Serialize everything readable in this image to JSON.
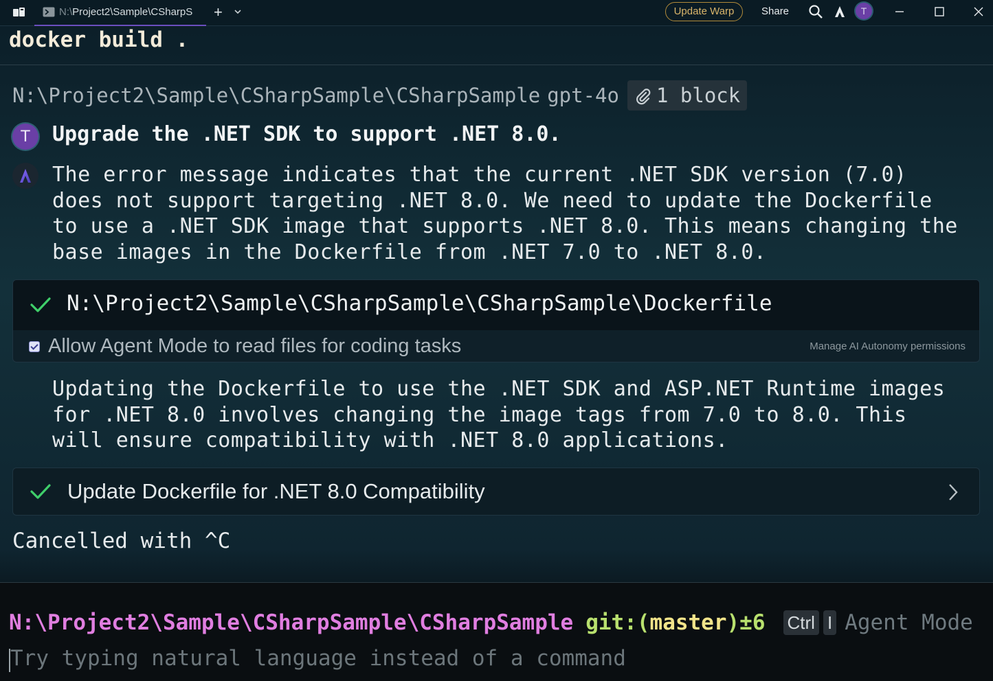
{
  "titlebar": {
    "tab_title_prefix": "N:\\",
    "tab_title": "Project2\\Sample\\CSharpS",
    "new_tab": "+",
    "update_button": "Update Warp",
    "share_button": "Share",
    "avatar_initial": "T"
  },
  "command": {
    "text": "docker build ."
  },
  "context": {
    "path": "N:\\Project2\\Sample\\CSharpSample\\CSharpSample",
    "model": "gpt-4o",
    "attachment": "1 block"
  },
  "conversation": {
    "user_initial": "T",
    "user_message": "Upgrade the .NET SDK to support .NET 8.0.",
    "agent_reply_1": "The error message indicates that the current .NET SDK version (7.0)\ndoes not support targeting .NET 8.0. We need to update the Dockerfile\nto use a .NET SDK image that supports .NET 8.0. This means changing the\nbase images in the Dockerfile from .NET 7.0 to .NET 8.0.",
    "file_read": {
      "path": "N:\\Project2\\Sample\\CSharpSample\\CSharpSample\\Dockerfile",
      "permission_label": "Allow Agent Mode to read files for coding tasks",
      "permission_checked": true,
      "permission_link": "Manage AI Autonomy permissions"
    },
    "agent_reply_2": "Updating the Dockerfile to use the .NET SDK and ASP.NET Runtime images\nfor .NET 8.0 involves changing the image tags from 7.0 to 8.0. This\nwill ensure compatibility with .NET 8.0 applications.",
    "task": {
      "title": "Update Dockerfile for .NET 8.0 Compatibility"
    },
    "status": "Cancelled with ^C"
  },
  "prompt": {
    "path": "N:\\Project2\\Sample\\CSharpSample\\CSharpSample",
    "git_prefix": "git:(",
    "branch": "master",
    "git_suffix": ")±6",
    "key1": "Ctrl",
    "key2": "I",
    "mode": "Agent Mode",
    "placeholder": "Try typing natural language instead of a command"
  },
  "colors": {
    "accent": "#6b4fbf",
    "prompt_path": "#e07ee0",
    "git": "#b8e06e",
    "success": "#3fcf6a"
  }
}
